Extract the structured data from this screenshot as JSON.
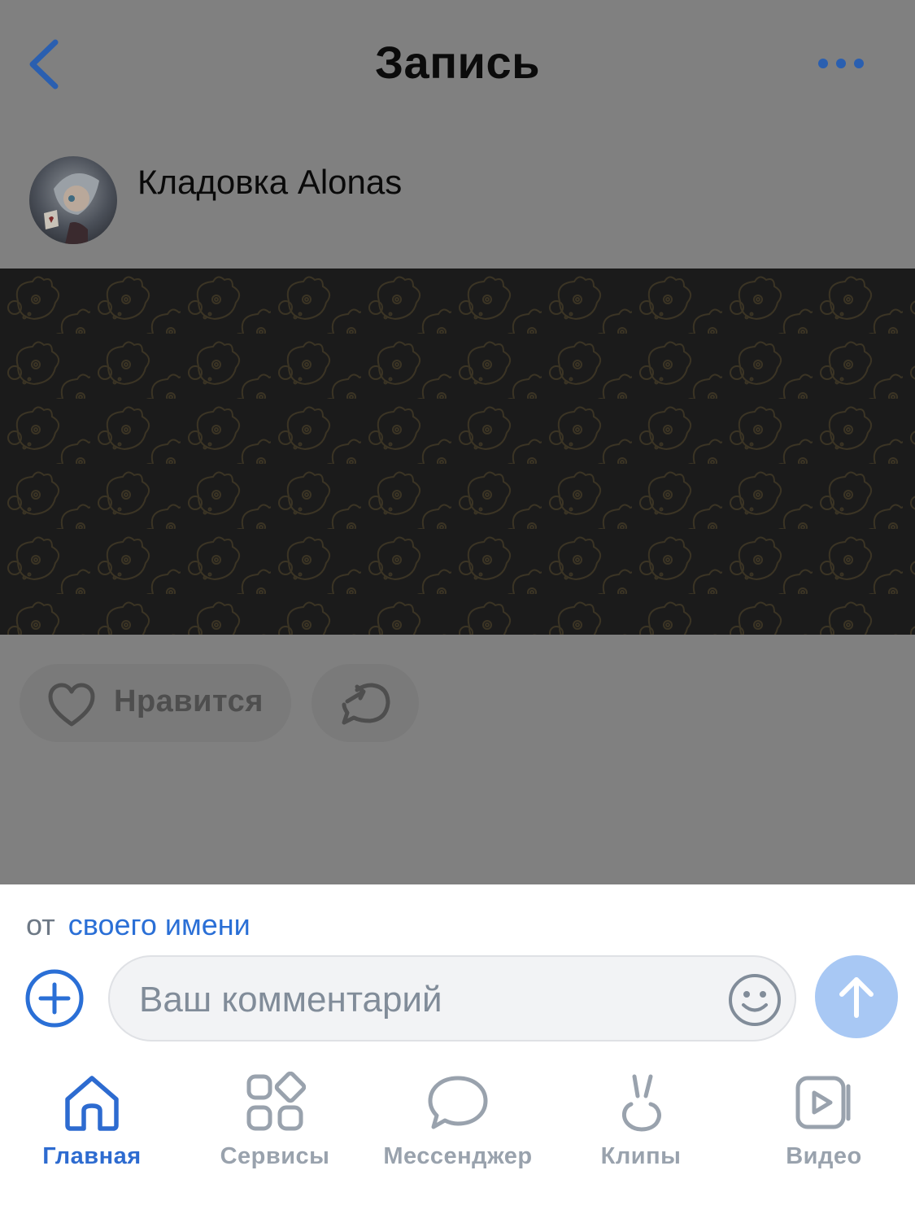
{
  "header": {
    "title": "Запись",
    "back_icon": "chevron-left-icon",
    "more_icon": "more-horizontal-icon"
  },
  "post": {
    "author": "Кладовка Alonas",
    "like_label": "Нравится",
    "like_icon": "heart-icon",
    "share_icon": "share-icon"
  },
  "composer": {
    "from_prefix": "от",
    "from_link": "своего имени",
    "placeholder": "Ваш комментарий",
    "add_icon": "plus-circle-icon",
    "emoji_icon": "smile-icon",
    "send_icon": "arrow-up-icon"
  },
  "tabs": [
    {
      "label": "Главная",
      "icon": "home-icon",
      "active": true
    },
    {
      "label": "Сервисы",
      "icon": "services-icon",
      "active": false
    },
    {
      "label": "Мессенджер",
      "icon": "message-icon",
      "active": false
    },
    {
      "label": "Клипы",
      "icon": "clips-icon",
      "active": false
    },
    {
      "label": "Видео",
      "icon": "video-icon",
      "active": false
    }
  ],
  "colors": {
    "accent": "#2a6fd6",
    "overlay": "#808080",
    "banner": "#1b1b1b",
    "send_button": "#a8c8f4",
    "inactive_tab": "#99a2ad"
  }
}
